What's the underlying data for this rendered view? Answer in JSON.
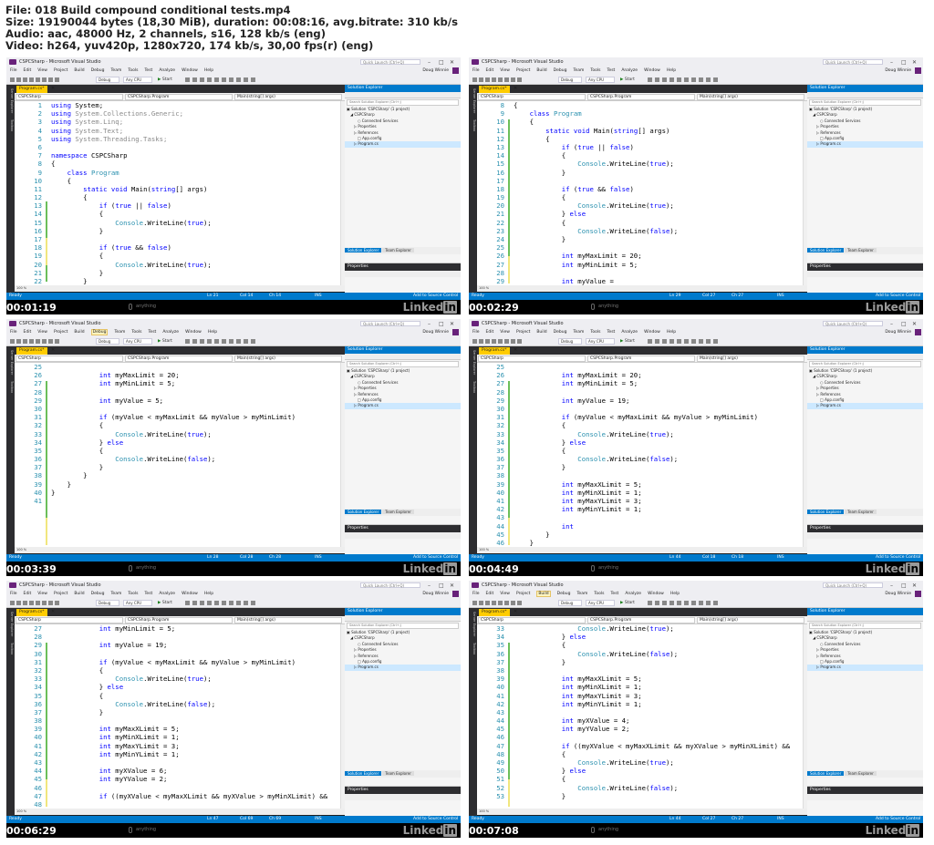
{
  "header": {
    "lines": [
      "File: 018 Build compound conditional tests.mp4",
      "Size: 19190044 bytes (18,30 MiB), duration: 00:08:16, avg.bitrate: 310 kb/s",
      "Audio: aac, 48000 Hz, 2 channels, s16, 128 kb/s (eng)",
      "Video: h264, yuv420p, 1280x720, 174 kb/s, 30,00 fps(r) (eng)"
    ]
  },
  "ide": {
    "title": "CSPCSharp - Microsoft Visual Studio",
    "quick_launch": "Quick Launch (Ctrl+Q)",
    "user": "Doug Winnie",
    "menu": [
      "File",
      "Edit",
      "View",
      "Project",
      "Build",
      "Debug",
      "Team",
      "Tools",
      "Test",
      "Analyze",
      "Window",
      "Help"
    ],
    "toolbar": {
      "config": "Debug",
      "platform": "Any CPU",
      "start": "Start"
    },
    "side_tabs": [
      "Server Explorer",
      "Toolbox"
    ],
    "file_tab": "Program.cs*",
    "nav": {
      "project": "CSPCSharp",
      "class": "CSPCSharp.Program",
      "method": "Main(string[] args)"
    },
    "zoom": "100 %",
    "solution_explorer": {
      "title": "Solution Explorer",
      "search": "Search Solution Explorer (Ctrl+;)",
      "items": [
        "Solution 'CSPCSharp' (1 project)",
        "CSPCSharp",
        "Connected Services",
        "Properties",
        "References",
        "App.config",
        "Program.cs"
      ],
      "tabs": [
        "Solution Explorer",
        "Team Explorer"
      ]
    },
    "properties": {
      "title": "Properties"
    },
    "status": {
      "ready": "Ready",
      "ins": "INS",
      "source_control": "Add to Source Control"
    }
  },
  "watermark": {
    "anything": "anything",
    "brand": "Linked",
    "brand_in": "in"
  },
  "frames": [
    {
      "timestamp": "00:01:19",
      "mode": "dark",
      "status": {
        "ln": "Ln 21",
        "col": "Col 14",
        "ch": "Ch 14"
      },
      "code": [
        [
          "1",
          "using System;"
        ],
        [
          "2",
          "using System.Collections.Generic;"
        ],
        [
          "3",
          "using System.Linq;"
        ],
        [
          "4",
          "using System.Text;"
        ],
        [
          "5",
          "using System.Threading.Tasks;"
        ],
        [
          "6",
          ""
        ],
        [
          "7",
          "namespace CSPCSharp"
        ],
        [
          "8",
          "{"
        ],
        [
          "9",
          "    class Program"
        ],
        [
          "10",
          "    {"
        ],
        [
          "11",
          "        static void Main(string[] args)"
        ],
        [
          "12",
          "        {"
        ],
        [
          "13",
          "            if (true || false)"
        ],
        [
          "14",
          "            {"
        ],
        [
          "15",
          "                Console.WriteLine(true);"
        ],
        [
          "16",
          "            }"
        ],
        [
          "17",
          ""
        ],
        [
          "18",
          "            if (true && false)"
        ],
        [
          "19",
          "            {"
        ],
        [
          "20",
          "                Console.WriteLine(true);"
        ],
        [
          "21",
          "            }"
        ],
        [
          "22",
          "        }"
        ]
      ]
    },
    {
      "timestamp": "00:02:29",
      "mode": "dark",
      "status": {
        "ln": "Ln 29",
        "col": "Col 27",
        "ch": "Ch 27"
      },
      "code": [
        [
          "8",
          "{"
        ],
        [
          "9",
          "    class Program"
        ],
        [
          "10",
          "    {"
        ],
        [
          "11",
          "        static void Main(string[] args)"
        ],
        [
          "12",
          "        {"
        ],
        [
          "13",
          "            if (true || false)"
        ],
        [
          "14",
          "            {"
        ],
        [
          "15",
          "                Console.WriteLine(true);"
        ],
        [
          "16",
          "            }"
        ],
        [
          "17",
          ""
        ],
        [
          "18",
          "            if (true && false)"
        ],
        [
          "19",
          "            {"
        ],
        [
          "20",
          "                Console.WriteLine(true);"
        ],
        [
          "21",
          "            } else"
        ],
        [
          "22",
          "            {"
        ],
        [
          "23",
          "                Console.WriteLine(false);"
        ],
        [
          "24",
          "            }"
        ],
        [
          "25",
          ""
        ],
        [
          "26",
          "            int myMaxLimit = 20;"
        ],
        [
          "27",
          "            int myMinLimit = 5;"
        ],
        [
          "28",
          ""
        ],
        [
          "29",
          "            int myValue = "
        ]
      ]
    },
    {
      "timestamp": "00:03:39",
      "mode": "dark",
      "status": {
        "ln": "Ln 28",
        "col": "Col 28",
        "ch": "Ch 28"
      },
      "code": [
        [
          "25",
          ""
        ],
        [
          "26",
          "            int myMaxLimit = 20;"
        ],
        [
          "27",
          "            int myMinLimit = 5;"
        ],
        [
          "28",
          ""
        ],
        [
          "29",
          "            int myValue = 5;"
        ],
        [
          "30",
          ""
        ],
        [
          "31",
          "            if (myValue < myMaxLimit && myValue > myMinLimit)"
        ],
        [
          "32",
          "            {"
        ],
        [
          "33",
          "                Console.WriteLine(true);"
        ],
        [
          "34",
          "            } else"
        ],
        [
          "35",
          "            {"
        ],
        [
          "36",
          "                Console.WriteLine(false);"
        ],
        [
          "37",
          "            }"
        ],
        [
          "38",
          "        }"
        ],
        [
          "39",
          "    }"
        ],
        [
          "40",
          "}"
        ],
        [
          "41",
          ""
        ]
      ]
    },
    {
      "timestamp": "00:04:49",
      "mode": "light",
      "status": {
        "ln": "Ln 44",
        "col": "Col 18",
        "ch": "Ch 18"
      },
      "code": [
        [
          "25",
          ""
        ],
        [
          "26",
          "            int myMaxLimit = 20;"
        ],
        [
          "27",
          "            int myMinLimit = 5;"
        ],
        [
          "28",
          ""
        ],
        [
          "29",
          "            int myValue = 19;"
        ],
        [
          "30",
          ""
        ],
        [
          "31",
          "            if (myValue < myMaxLimit && myValue > myMinLimit)"
        ],
        [
          "32",
          "            {"
        ],
        [
          "33",
          "                Console.WriteLine(true);"
        ],
        [
          "34",
          "            } else"
        ],
        [
          "35",
          "            {"
        ],
        [
          "36",
          "                Console.WriteLine(false);"
        ],
        [
          "37",
          "            }"
        ],
        [
          "38",
          ""
        ],
        [
          "39",
          "            int myMaxXLimit = 5;"
        ],
        [
          "40",
          "            int myMinXLimit = 1;"
        ],
        [
          "41",
          "            int myMaxYLimit = 3;"
        ],
        [
          "42",
          "            int myMinYLimit = 1;"
        ],
        [
          "43",
          ""
        ],
        [
          "44",
          "            int "
        ],
        [
          "45",
          "        }"
        ],
        [
          "46",
          "    }"
        ],
        [
          "47",
          "}"
        ]
      ]
    },
    {
      "timestamp": "00:06:29",
      "mode": "dark",
      "status": {
        "ln": "Ln 47",
        "col": "Col 69",
        "ch": "Ch 69"
      },
      "code": [
        [
          "27",
          "            int myMinLimit = 5;"
        ],
        [
          "28",
          ""
        ],
        [
          "29",
          "            int myValue = 19;"
        ],
        [
          "30",
          ""
        ],
        [
          "31",
          "            if (myValue < myMaxLimit && myValue > myMinLimit)"
        ],
        [
          "32",
          "            {"
        ],
        [
          "33",
          "                Console.WriteLine(true);"
        ],
        [
          "34",
          "            } else"
        ],
        [
          "35",
          "            {"
        ],
        [
          "36",
          "                Console.WriteLine(false);"
        ],
        [
          "37",
          "            }"
        ],
        [
          "38",
          ""
        ],
        [
          "39",
          "            int myMaxXLimit = 5;"
        ],
        [
          "40",
          "            int myMinXLimit = 1;"
        ],
        [
          "41",
          "            int myMaxYLimit = 3;"
        ],
        [
          "42",
          "            int myMinYLimit = 1;"
        ],
        [
          "43",
          ""
        ],
        [
          "44",
          "            int myXValue = 6;"
        ],
        [
          "45",
          "            int myYValue = 2;"
        ],
        [
          "46",
          ""
        ],
        [
          "47",
          "            if ((myXValue < myMaxXLimit && myXValue > myMinXLimit) &&"
        ],
        [
          "48",
          ""
        ]
      ]
    },
    {
      "timestamp": "00:07:08",
      "mode": "dark",
      "status": {
        "ln": "Ln 44",
        "col": "Col 27",
        "ch": "Ch 27"
      },
      "code": [
        [
          "33",
          "                Console.WriteLine(true);"
        ],
        [
          "34",
          "            } else"
        ],
        [
          "35",
          "            {"
        ],
        [
          "36",
          "                Console.WriteLine(false);"
        ],
        [
          "37",
          "            }"
        ],
        [
          "38",
          ""
        ],
        [
          "39",
          "            int myMaxXLimit = 5;"
        ],
        [
          "40",
          "            int myMinXLimit = 1;"
        ],
        [
          "41",
          "            int myMaxYLimit = 3;"
        ],
        [
          "42",
          "            int myMinYLimit = 1;"
        ],
        [
          "43",
          ""
        ],
        [
          "44",
          "            int myXValue = 4;"
        ],
        [
          "45",
          "            int myYValue = 2;"
        ],
        [
          "46",
          ""
        ],
        [
          "47",
          "            if ((myXValue < myMaxXLimit && myXValue > myMinXLimit) &&"
        ],
        [
          "48",
          "            {"
        ],
        [
          "49",
          "                Console.WriteLine(true);"
        ],
        [
          "50",
          "            } else"
        ],
        [
          "51",
          "            {"
        ],
        [
          "52",
          "                Console.WriteLine(false);"
        ],
        [
          "53",
          "            }"
        ]
      ]
    }
  ]
}
